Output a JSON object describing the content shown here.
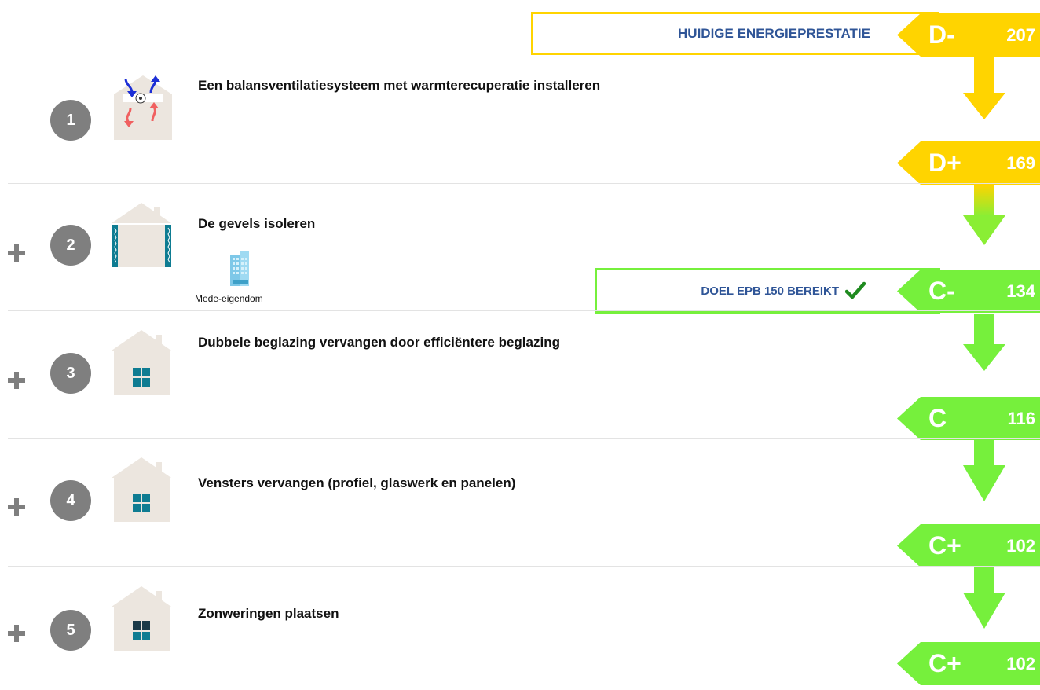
{
  "current_banner": {
    "label": "HUIDIGE ENERGIEPRESTATIE"
  },
  "goal_banner": {
    "label": "DOEL EPB 150 BEREIKT"
  },
  "colors": {
    "yellow": "#ffd400",
    "yellow_green": "#c8ea2a",
    "green": "#76f03c",
    "heading_blue": "#2f5597",
    "check_green": "#1f8a1f"
  },
  "badges": [
    {
      "letter": "D-",
      "value": "207"
    },
    {
      "letter": "D+",
      "value": "169"
    },
    {
      "letter": "C-",
      "value": "134"
    },
    {
      "letter": "C",
      "value": "116"
    },
    {
      "letter": "C+",
      "value": "102"
    },
    {
      "letter": "C+",
      "value": "102"
    }
  ],
  "steps": [
    {
      "number": "1",
      "title": "Een balansventilatiesysteem met warmterecuperatie installeren",
      "icon": "ventilation-icon"
    },
    {
      "number": "2",
      "title": "De gevels isoleren",
      "icon": "facade-insulation-icon",
      "extra_label": "Mede-eigendom"
    },
    {
      "number": "3",
      "title": "Dubbele beglazing vervangen door efficiëntere beglazing",
      "icon": "window-icon"
    },
    {
      "number": "4",
      "title": "Vensters vervangen (profiel, glaswerk en panelen)",
      "icon": "window-icon"
    },
    {
      "number": "5",
      "title": "Zonweringen plaatsen",
      "icon": "sunshade-icon"
    }
  ]
}
